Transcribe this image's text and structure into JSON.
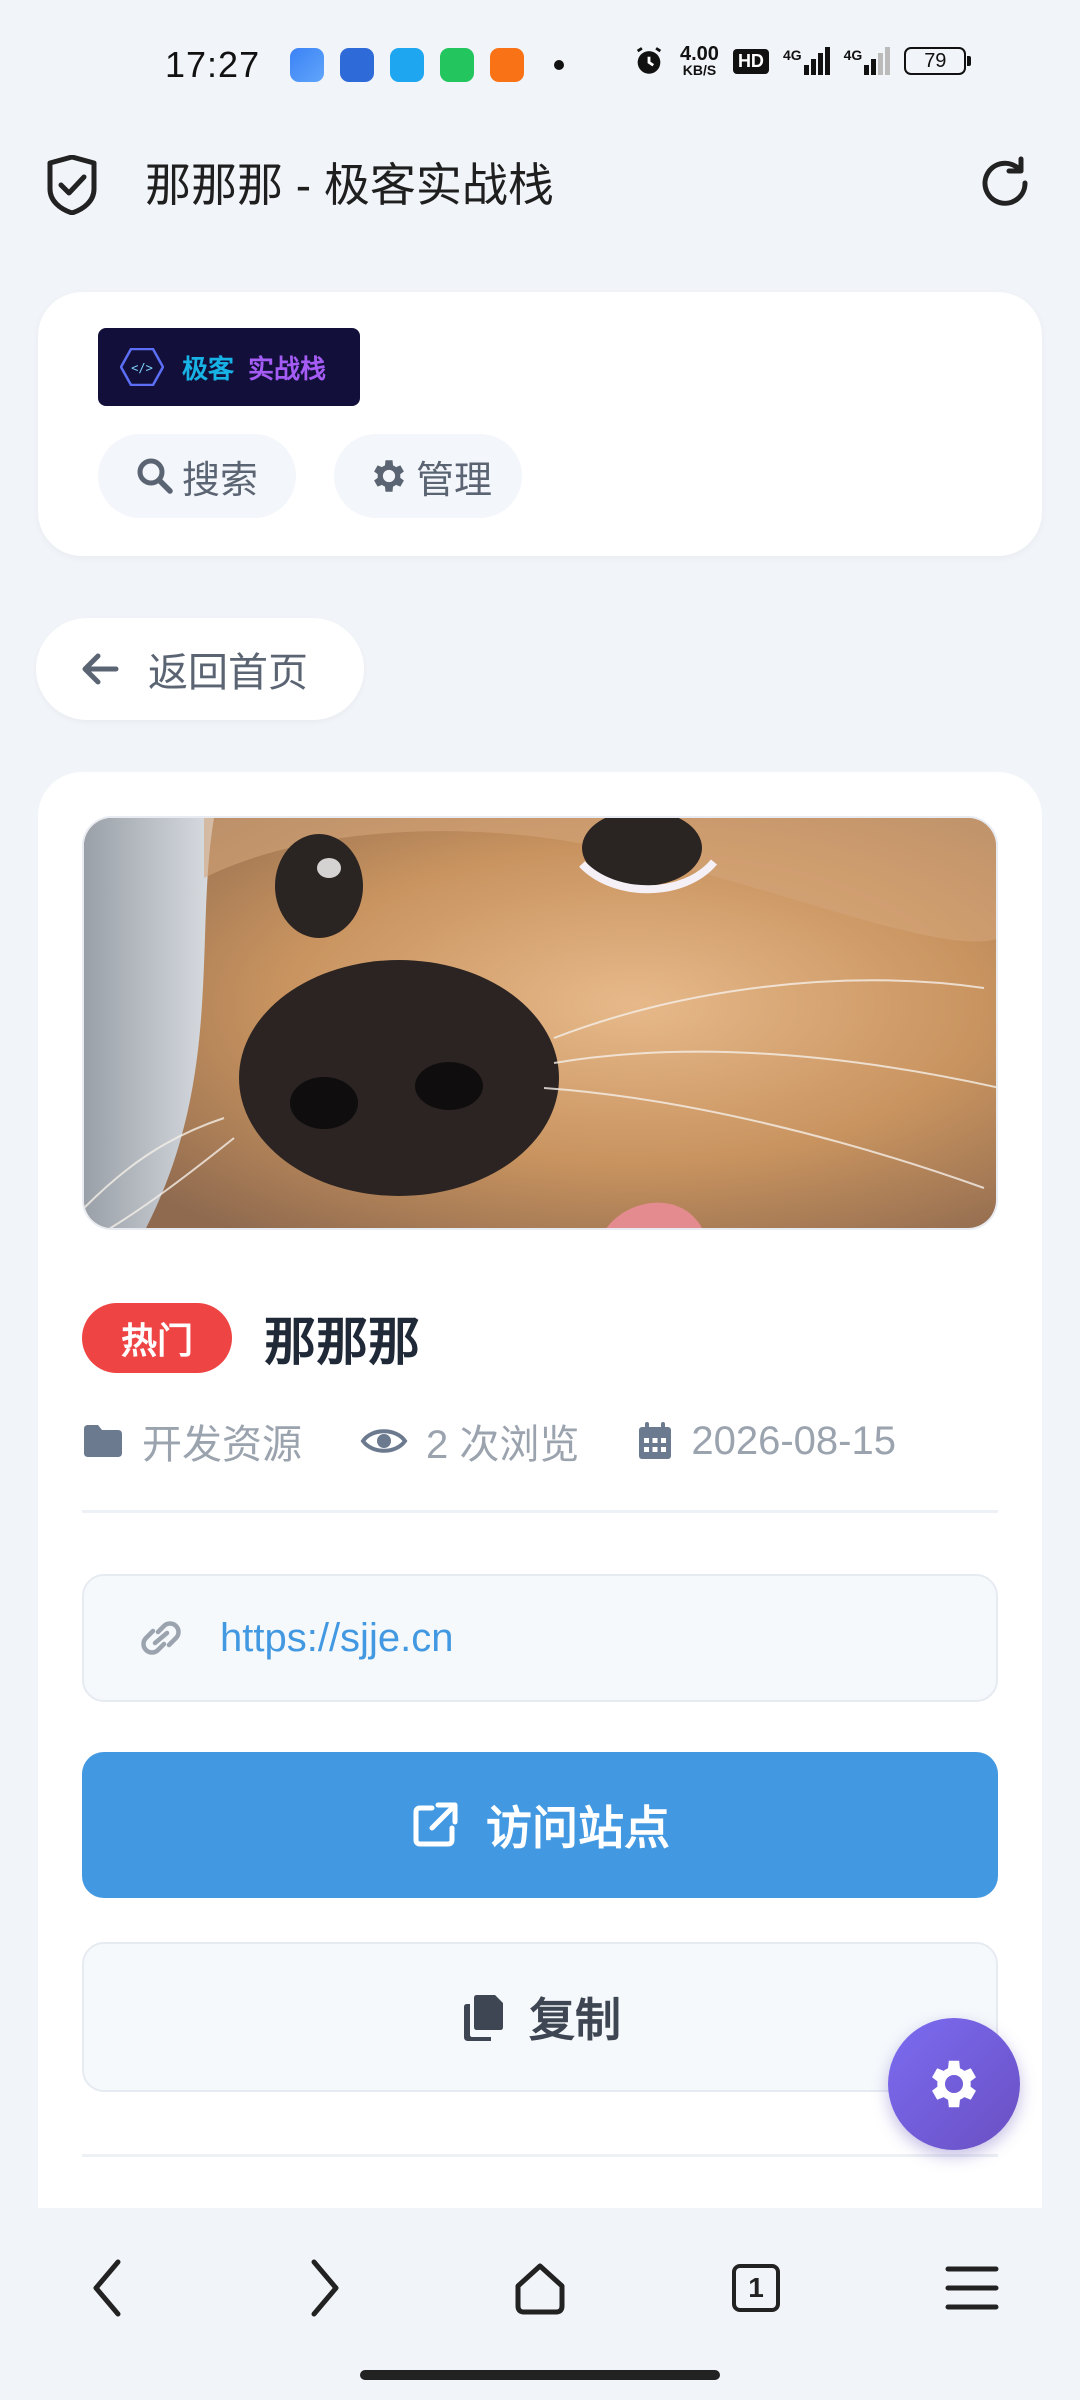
{
  "status_bar": {
    "time": "17:27",
    "net_speed_value": "4.00",
    "net_speed_unit": "KB/S",
    "hd_label": "HD",
    "signal1_label": "4G",
    "signal2_label": "4G",
    "battery_level": "79"
  },
  "title_bar": {
    "title": "那那那 - 极客实战栈"
  },
  "header": {
    "logo_text_primary": "极客",
    "logo_text_secondary": "实战栈",
    "search_label": "搜索",
    "manage_label": "管理"
  },
  "back_label": "返回首页",
  "item": {
    "badge": "热门",
    "title": "那那那",
    "category": "开发资源",
    "views": "2 次浏览",
    "date": "2026-08-15",
    "url": "https://sjje.cn",
    "visit_label": "访问站点",
    "copy_label": "复制"
  },
  "bottom_nav": {
    "tab_count": "1"
  },
  "colors": {
    "accent_blue": "#4299e1",
    "hot_red": "#ef4444",
    "fab_purple": "#6a4fc2"
  }
}
